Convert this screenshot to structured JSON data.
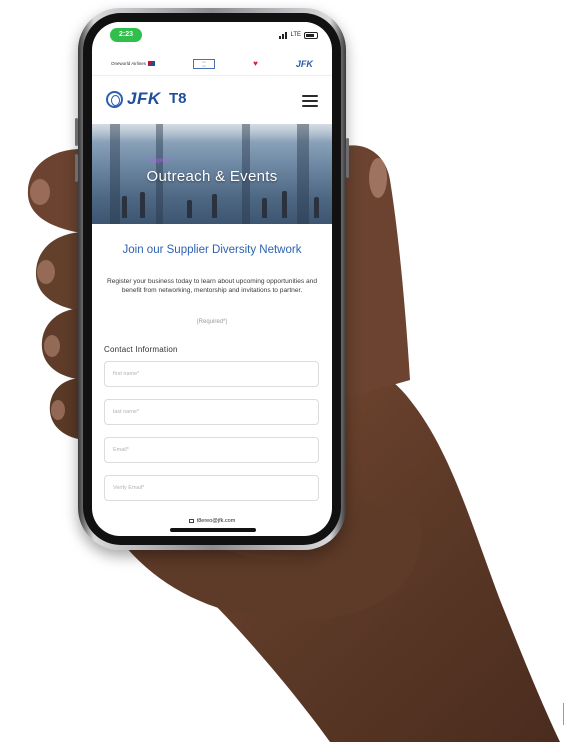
{
  "status_bar": {
    "time": "2:23",
    "network": "LTE"
  },
  "partners": {
    "oneworld": "Oneworld Airlines",
    "jfk_mark": "JFK"
  },
  "header": {
    "logo_text": "JFK",
    "terminal_text": "T8"
  },
  "hero": {
    "tag": "Popular",
    "title": "Outreach & Events"
  },
  "content": {
    "join_title": "Join our Supplier Diversity Network",
    "description": "Register your business today to learn about upcoming opportunities and benefit from networking, mentorship and invitations to partner.",
    "required_note": "(Required*)",
    "section_label": "Contact Information"
  },
  "form": {
    "first_name_placeholder": "first name*",
    "last_name_placeholder": "last name*",
    "email_placeholder": "Email*",
    "verify_email_placeholder": "Verify Email*"
  },
  "footer": {
    "email": "t8ereo@jfk.com"
  },
  "colors": {
    "brand_blue": "#2e62b0",
    "accent_purple": "#b061e8",
    "status_green": "#2fbf4a",
    "skin": "#6b4330"
  }
}
